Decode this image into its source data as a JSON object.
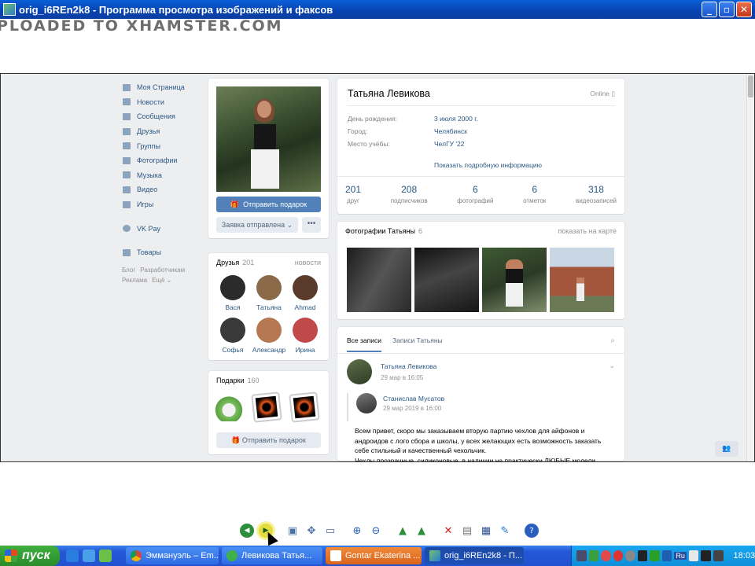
{
  "window": {
    "title": "orig_i6REn2k8 - Программа просмотра изображений и факсов",
    "btn_min": "_",
    "btn_max": "▫",
    "btn_close": "✕"
  },
  "watermark": "PLOADED TO XHAMSTER.COM",
  "vk": {
    "nav": [
      {
        "label": "Моя Страница",
        "icon": "home-icon"
      },
      {
        "label": "Новости",
        "icon": "news-icon"
      },
      {
        "label": "Сообщения",
        "icon": "messages-icon"
      },
      {
        "label": "Друзья",
        "icon": "friends-icon"
      },
      {
        "label": "Группы",
        "icon": "groups-icon"
      },
      {
        "label": "Фотографии",
        "icon": "photos-icon"
      },
      {
        "label": "Музыка",
        "icon": "music-icon"
      },
      {
        "label": "Видео",
        "icon": "video-icon"
      },
      {
        "label": "Игры",
        "icon": "games-icon"
      },
      {
        "label": "VK Pay",
        "icon": "vkpay-icon"
      },
      {
        "label": "Товары",
        "icon": "goods-icon"
      }
    ],
    "footer": {
      "blog": "Блог",
      "dev": "Разработчикам",
      "ads": "Реклама",
      "more": "Ещё ⌄"
    },
    "send_gift": "Отправить подарок",
    "request_sent": "Заявка отправлена ⌄",
    "more_dots": "•••",
    "friends": {
      "title": "Друзья",
      "count": "201",
      "link": "новости",
      "items": [
        {
          "name": "Вася",
          "color": "#2b2b2b"
        },
        {
          "name": "Татьяна",
          "color": "#8b6a4a"
        },
        {
          "name": "Ahmad",
          "color": "#5a3a2a"
        },
        {
          "name": "Софья",
          "color": "#3a3a3a"
        },
        {
          "name": "Александр",
          "color": "#b57850"
        },
        {
          "name": "Ирина",
          "color": "#c04a4a"
        }
      ]
    },
    "gifts": {
      "title": "Подарки",
      "count": "160",
      "button": "Отправить подарок"
    },
    "profile": {
      "name": "Татьяна Левикова",
      "status": "Online ▯",
      "rows": [
        {
          "k": "День рождения:",
          "v": "3 июля 2000 г."
        },
        {
          "k": "Город:",
          "v": "Челябинск"
        },
        {
          "k": "Место учёбы:",
          "v": "ЧелГУ '22"
        }
      ],
      "more_info": "Показать подробную информацию",
      "counters": [
        {
          "n": "201",
          "l": "друг"
        },
        {
          "n": "208",
          "l": "подписчиков"
        },
        {
          "n": "6",
          "l": "фотографий"
        },
        {
          "n": "6",
          "l": "отметок"
        },
        {
          "n": "318",
          "l": "видеозаписей"
        }
      ]
    },
    "photos": {
      "title": "Фотографии Татьяны",
      "count": "6",
      "link": "показать на карте"
    },
    "wall": {
      "tab_all": "Все записи",
      "tab_own": "Записи Татьяны",
      "post_author": "Татьяна Левикова",
      "post_date": "29 мар в 16:05",
      "repost_author": "Станислав Мусатов",
      "repost_date": "29 мар 2019 в 16:00",
      "text1": "Всем привет, скоро мы заказываем вторую партию чехлов для айфонов и",
      "text2": "андроидов с лого сбора и школы, у всех желающих есть возможность заказать",
      "text3": "себе стильный и качественный чехольчик.",
      "text4": "Чехлы прозрачные, силиконовые, в наличии на практически ЛЮБЫЕ модели"
    }
  },
  "taskbar": {
    "start": "пуск",
    "tasks": [
      {
        "label": "Эммануэль – Em...",
        "icon_color": "#e8a23a"
      },
      {
        "label": "Левикова Татья...",
        "icon_color": "#3fb04a"
      },
      {
        "label": "Gontar Ekaterina ...",
        "icon_color": "#ffffff"
      },
      {
        "label": "orig_i6REn2k8 - П...",
        "icon_color": "#6fc36f"
      }
    ],
    "lang": "Ru",
    "clock": "18:03"
  }
}
